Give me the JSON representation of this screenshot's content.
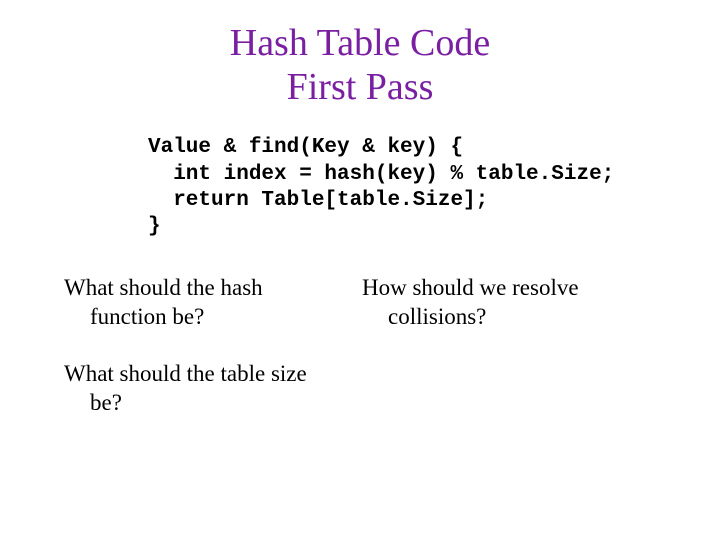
{
  "title": {
    "line1": "Hash Table Code",
    "line2": "First Pass"
  },
  "code": {
    "l1": "Value & find(Key & key) {",
    "l2": "  int index = hash(key) % table.Size;",
    "l3": "  return Table[table.Size];",
    "l4": "}"
  },
  "questions": {
    "left": {
      "q1_l1": "What should the hash",
      "q1_l2": "function be?",
      "q2_l1": "What should the table size",
      "q2_l2": "be?"
    },
    "right": {
      "q1_l1": "How should we resolve",
      "q1_l2": "collisions?"
    }
  }
}
